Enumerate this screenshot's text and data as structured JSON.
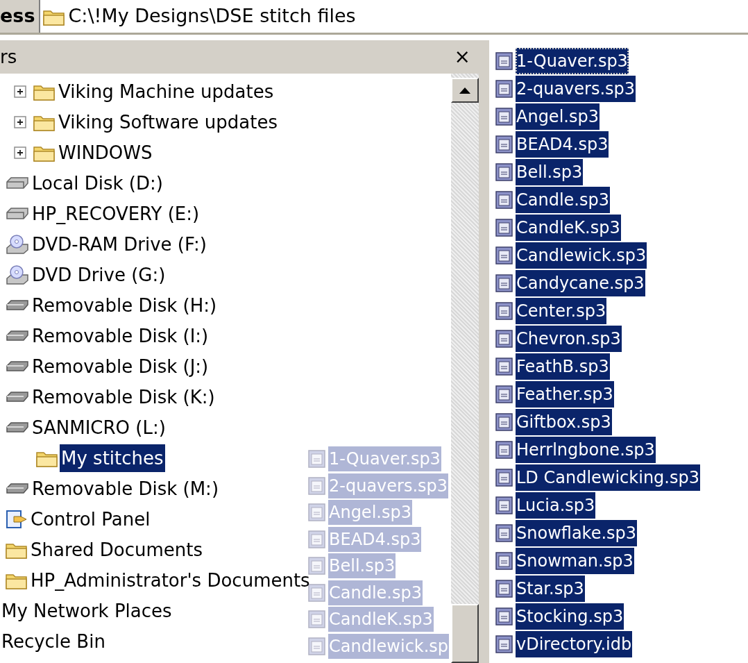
{
  "address_bar": {
    "label": "ess",
    "path": "C:\\!My Designs\\DSE stitch files"
  },
  "folders_pane": {
    "title": "rs",
    "close": "×"
  },
  "tree": {
    "clipped_children": [
      {
        "label": "Viking Machine updates",
        "kind": "folder",
        "expanded": false,
        "selected": false
      },
      {
        "label": "Viking Software updates",
        "kind": "folder",
        "expanded": false,
        "selected": false
      },
      {
        "label": "WINDOWS",
        "kind": "folder",
        "expanded": false,
        "selected": false
      }
    ],
    "items": [
      {
        "label": "Local Disk (D:)",
        "kind": "disk",
        "selected": false
      },
      {
        "label": "HP_RECOVERY (E:)",
        "kind": "disk",
        "selected": false
      },
      {
        "label": "DVD-RAM Drive (F:)",
        "kind": "cd",
        "selected": false
      },
      {
        "label": "DVD Drive (G:)",
        "kind": "cd",
        "selected": false
      },
      {
        "label": "Removable Disk (H:)",
        "kind": "removable",
        "selected": false
      },
      {
        "label": "Removable Disk (I:)",
        "kind": "removable",
        "selected": false
      },
      {
        "label": "Removable Disk (J:)",
        "kind": "removable",
        "selected": false
      },
      {
        "label": "Removable Disk (K:)",
        "kind": "removable",
        "selected": false
      },
      {
        "label": "SANMICRO (L:)",
        "kind": "removable",
        "selected": false,
        "children": [
          {
            "label": "My stitches",
            "kind": "folder",
            "selected": true
          }
        ]
      },
      {
        "label": "Removable Disk (M:)",
        "kind": "removable",
        "selected": false
      },
      {
        "label": "Control Panel",
        "kind": "control",
        "selected": false
      },
      {
        "label": "Shared Documents",
        "kind": "folder",
        "selected": false
      },
      {
        "label": "HP_Administrator's Documents",
        "kind": "folder",
        "selected": false
      },
      {
        "label": "My Network Places",
        "kind": "none",
        "selected": false
      },
      {
        "label": "Recycle Bin",
        "kind": "none",
        "selected": false
      }
    ]
  },
  "drag_ghost": [
    "1-Quaver.sp3",
    "2-quavers.sp3",
    "Angel.sp3",
    "BEAD4.sp3",
    "Bell.sp3",
    "Candle.sp3",
    "CandleK.sp3",
    "Candlewick.sp"
  ],
  "files": [
    {
      "name": "1-Quaver.sp3",
      "selected": true,
      "focused": true
    },
    {
      "name": "2-quavers.sp3",
      "selected": true,
      "focused": false
    },
    {
      "name": "Angel.sp3",
      "selected": true,
      "focused": false
    },
    {
      "name": "BEAD4.sp3",
      "selected": true,
      "focused": false
    },
    {
      "name": "Bell.sp3",
      "selected": true,
      "focused": false
    },
    {
      "name": "Candle.sp3",
      "selected": true,
      "focused": false
    },
    {
      "name": "CandleK.sp3",
      "selected": true,
      "focused": false
    },
    {
      "name": "Candlewick.sp3",
      "selected": true,
      "focused": false
    },
    {
      "name": "Candycane.sp3",
      "selected": true,
      "focused": false
    },
    {
      "name": "Center.sp3",
      "selected": true,
      "focused": false
    },
    {
      "name": "Chevron.sp3",
      "selected": true,
      "focused": false
    },
    {
      "name": "FeathB.sp3",
      "selected": true,
      "focused": false
    },
    {
      "name": "Feather.sp3",
      "selected": true,
      "focused": false
    },
    {
      "name": "Giftbox.sp3",
      "selected": true,
      "focused": false
    },
    {
      "name": "Herrlngbone.sp3",
      "selected": true,
      "focused": false
    },
    {
      "name": "LD Candlewicking.sp3",
      "selected": true,
      "focused": false
    },
    {
      "name": "Lucia.sp3",
      "selected": true,
      "focused": false
    },
    {
      "name": "Snowflake.sp3",
      "selected": true,
      "focused": false
    },
    {
      "name": "Snowman.sp3",
      "selected": true,
      "focused": false
    },
    {
      "name": "Star.sp3",
      "selected": true,
      "focused": false
    },
    {
      "name": "Stocking.sp3",
      "selected": true,
      "focused": false
    },
    {
      "name": "vDirectory.idb",
      "selected": true,
      "focused": false
    }
  ]
}
